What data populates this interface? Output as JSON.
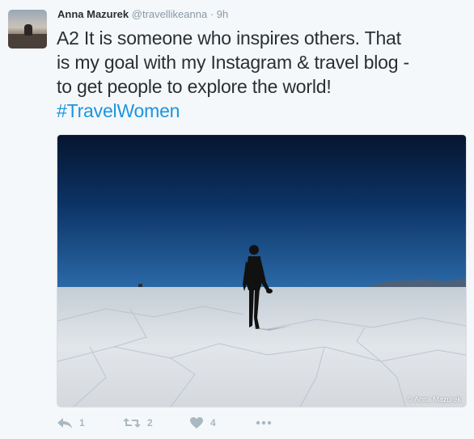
{
  "tweet": {
    "author_name": "Anna Mazurek",
    "handle": "@travellikeanna",
    "separator": "·",
    "time": "9h",
    "text_line1": "A2 It is someone who inspires others. That",
    "text_line2": "is my goal with my Instagram & travel blog -",
    "text_line3": "to get people to explore the world!",
    "hashtag": "#TravelWomen",
    "photo_credit": "© Anna Mazurek",
    "actions": {
      "reply_count": "1",
      "retweet_count": "2",
      "like_count": "4"
    }
  },
  "icons": {
    "reply": "reply-icon",
    "retweet": "retweet-icon",
    "like": "heart-icon",
    "more": "more-dots-icon"
  },
  "colors": {
    "hashtag": "#1b95e0",
    "action_icon": "#aab8c2",
    "name": "#292f33",
    "meta": "#8899a6",
    "background": "#f5f8fa"
  }
}
